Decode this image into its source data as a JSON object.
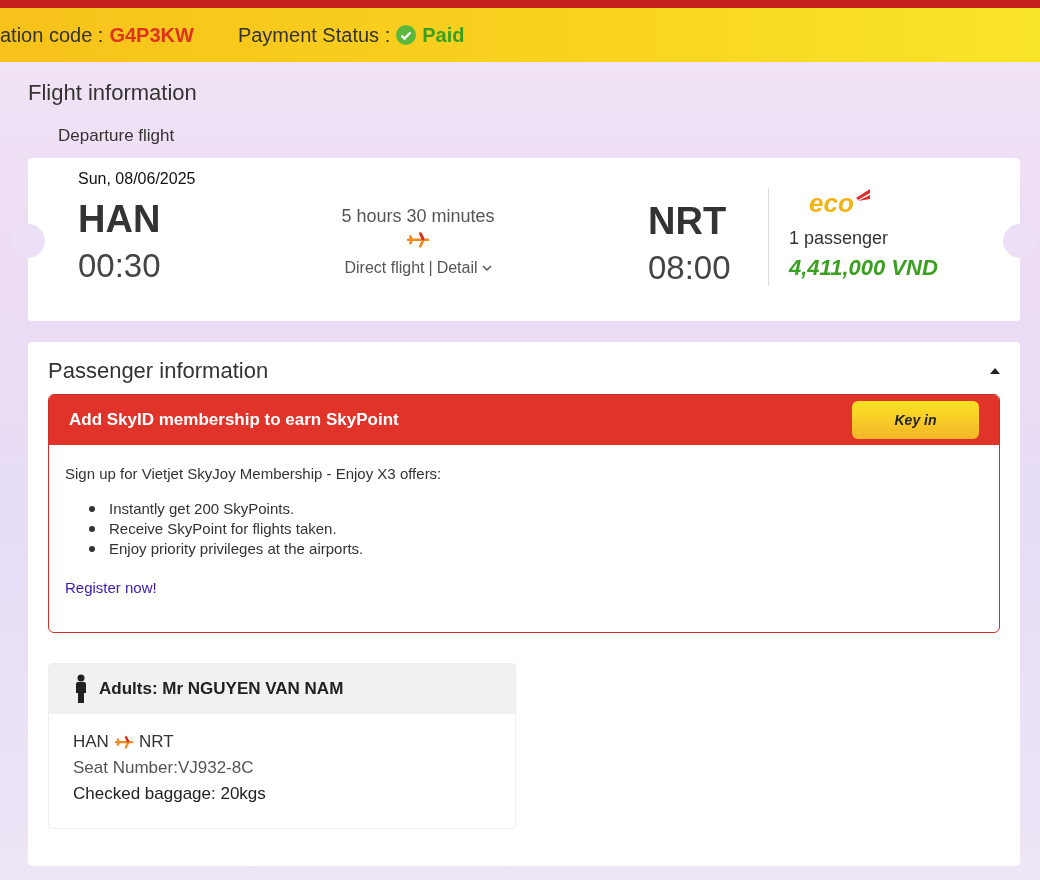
{
  "booking": {
    "code_label": "ation code :",
    "code": "G4P3KW",
    "status_label": "Payment Status :",
    "status": "Paid",
    "paid": true
  },
  "flight_information": {
    "title": "Flight information",
    "subtitle": "Departure flight",
    "flight": {
      "date": "Sun, 08/06/2025",
      "from_code": "HAN",
      "from_time": "00:30",
      "duration": "5 hours 30 minutes",
      "stops": "Direct flight",
      "separator": "|",
      "detail": "Detail",
      "to_code": "NRT",
      "to_time": "08:00",
      "fare_logo": "eco",
      "passengers": "1 passenger",
      "price": "4,411,000 VND"
    }
  },
  "passenger_information": {
    "title": "Passenger information",
    "expanded": true,
    "membership": {
      "title": "Add SkyID membership to earn SkyPoint",
      "button": "Key in",
      "intro": "Sign up for Vietjet SkyJoy Membership - Enjoy X3 offers:",
      "benefits": [
        "Instantly get 200 SkyPoints.",
        "Receive SkyPoint for flights taken.",
        "Enjoy priority privileges at the airports."
      ],
      "link": "Register now!"
    },
    "passengers": [
      {
        "label": "Adults: Mr NGUYEN VAN NAM",
        "route_from": "HAN",
        "route_to": "NRT",
        "seat": "Seat Number:VJ932-8C",
        "baggage": "Checked baggage: 20kgs"
      }
    ]
  }
}
